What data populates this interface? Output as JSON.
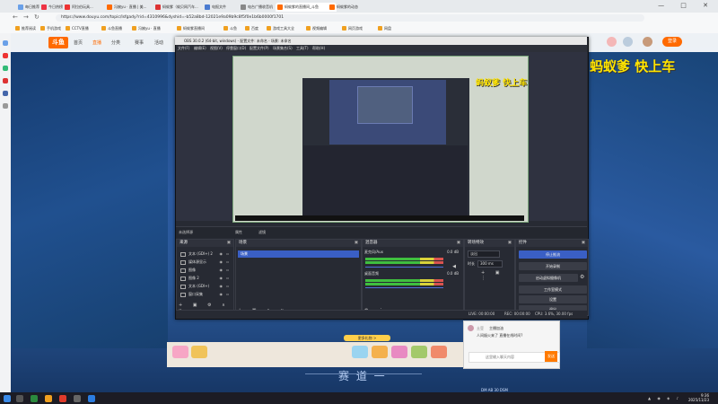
{
  "browser": {
    "tabs": [
      {
        "label": "每日推荐"
      },
      {
        "label": "今日热榜"
      },
      {
        "label": "阿拉伯玩具..."
      },
      {
        "label": "冯婉yu · 直播 | 美..."
      },
      {
        "label": "蚂蚁爹（蚁贝网汽车..."
      },
      {
        "label": "电报文件"
      },
      {
        "label": "电台广播收音机"
      },
      {
        "label": "蚂蚁爹的直播间_斗鱼"
      },
      {
        "label": "蚂蚁爹的动态"
      }
    ],
    "url": "https://www.douyu.com/topic/lsfgady?rid=4310996&dyshid=-b52a8bd-12021e9a09b9c8f5f0e1b6b0000f1701",
    "bookmarks": [
      "推荐阅读",
      "手机游戏",
      "CCTV直播",
      "斗鱼直播",
      "冯婉yu · 直播",
      "蚂蚁爹直播间",
      "斗鱼",
      "百度",
      "游戏工具大全",
      "视频编辑",
      "网页游戏",
      "网盘"
    ],
    "window_controls": "— □ ✕"
  },
  "douyu": {
    "logo": "斗鱼",
    "nav": [
      "首页",
      "直播",
      "分类",
      "赛事",
      "活动"
    ],
    "login_button": "登录",
    "overlay_title": "蚂蚁爹 快上车",
    "race_title": "赛 道 一",
    "sub_text": "DM AB 30 DSM"
  },
  "obs": {
    "title": "OBS 30.0.2 (64-bit, windows) - 配置文件: 未命名 - 场景: 未命名",
    "menu": [
      "文件(F)",
      "编辑(E)",
      "视图(V)",
      "停靠窗口(D)",
      "配置文件(P)",
      "场景集合(S)",
      "工具(T)",
      "帮助(H)"
    ],
    "canvas_title": "蚂蚁爹 快上车",
    "scene_bar": {
      "left": "未选择源",
      "properties": "属性",
      "filters": "滤镜"
    },
    "scenes_dock": {
      "title": "来源",
      "items": [
        "文本 (GDI+) 2",
        "媒体源显示",
        "图像",
        "图像 2",
        "文本 (GDI+)",
        "窗口采集"
      ]
    },
    "sources_dock": {
      "title": "场景",
      "items": [
        "场景"
      ]
    },
    "mixer": {
      "title": "混音器",
      "channels": [
        {
          "name": "麦克风/Aux",
          "db": "0.0 dB"
        },
        {
          "name": "桌面音频",
          "db": "0.0 dB"
        }
      ]
    },
    "transitions": {
      "title": "转场特效",
      "type": "淡出",
      "duration_label": "时长",
      "duration_value": "300 ms"
    },
    "controls": {
      "title": "控件",
      "buttons": [
        "停止推流",
        "开始录制",
        "启动虚拟摄像机",
        "工作室模式",
        "设置",
        "退出"
      ]
    },
    "status": {
      "live": "LIVE: 00:00:00",
      "rec": "REC: 00:00:00",
      "cpu": "CPU: 3.6%, 30.00 fps"
    }
  },
  "chat": {
    "user": "土豆",
    "line1": "主播加油",
    "line2": "人间烟火来了 直播在线时间?",
    "placeholder": "这里输入聊天内容",
    "send": "发送"
  },
  "gifts": {
    "button": "更多礼物 >"
  },
  "taskbar": {
    "time": "9:36",
    "date": "2025/11/23"
  }
}
